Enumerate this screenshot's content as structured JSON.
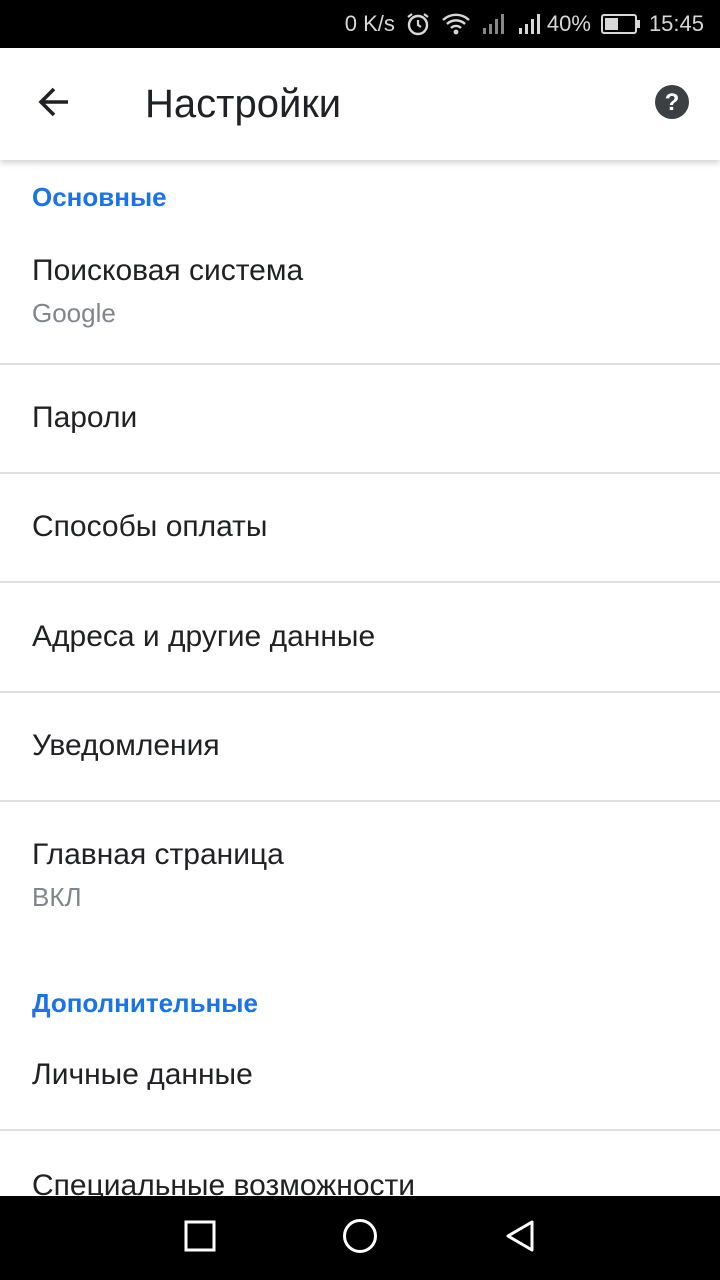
{
  "status_bar": {
    "net_speed": "0 K/s",
    "battery_percent": "40%",
    "time": "15:45",
    "icons": [
      "alarm-icon",
      "wifi-icon",
      "signal-icon",
      "signal-icon",
      "battery-icon"
    ]
  },
  "app_bar": {
    "title": "Настройки",
    "back_icon": "arrow-back-icon",
    "help_icon": "help-circle-icon"
  },
  "sections": {
    "basic": {
      "header": "Основные",
      "items": [
        {
          "title": "Поисковая система",
          "subtitle": "Google"
        },
        {
          "title": "Пароли"
        },
        {
          "title": "Способы оплаты"
        },
        {
          "title": "Адреса и другие данные"
        },
        {
          "title": "Уведомления"
        },
        {
          "title": "Главная страница",
          "subtitle": "ВКЛ"
        }
      ]
    },
    "advanced": {
      "header": "Дополнительные",
      "items": [
        {
          "title": "Личные данные"
        },
        {
          "title": "Специальные возможности"
        }
      ]
    }
  },
  "nav_bar": {
    "icons": [
      "recents-square-icon",
      "home-circle-icon",
      "back-triangle-icon"
    ]
  },
  "colors": {
    "accent": "#1a73e8",
    "text_primary": "#202124",
    "text_secondary": "#80868b",
    "divider": "#e0e0e0",
    "system_bar": "#000000"
  }
}
